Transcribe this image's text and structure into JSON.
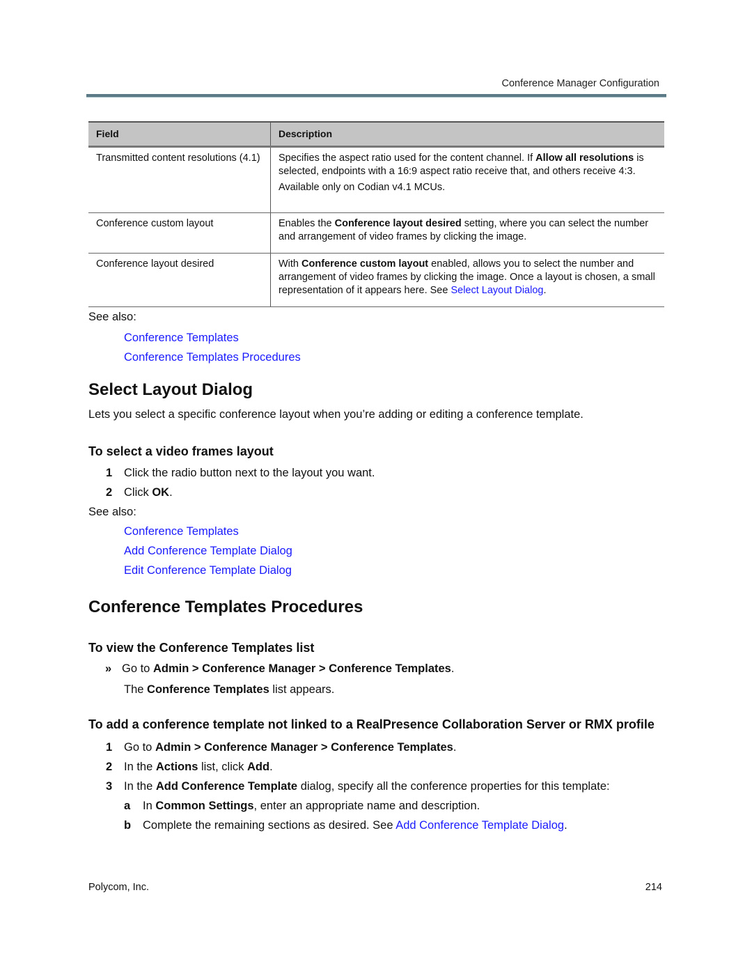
{
  "header": {
    "running_title": "Conference Manager Configuration",
    "bar_color": "#5b7a86"
  },
  "table": {
    "columns": [
      "Field",
      "Description"
    ],
    "rows": [
      {
        "field": "Transmitted content resolutions (4.1)",
        "desc1_pre": "Specifies the aspect ratio used for the content channel. If ",
        "desc1_bold": "Allow all resolutions",
        "desc1_post": " is selected, endpoints with a 16:9 aspect ratio receive that, and others receive 4:3.",
        "desc2": "Available only on Codian v4.1 MCUs."
      },
      {
        "field": "Conference custom layout",
        "desc1_pre": "Enables the ",
        "desc1_bold": "Conference layout desired",
        "desc1_post": " setting, where you can select the number and arrangement of video frames by clicking the image."
      },
      {
        "field": "Conference layout desired",
        "desc1_pre": "With ",
        "desc1_bold": "Conference custom layout",
        "desc1_post": " enabled, allows you to select the number and arrangement of video frames by clicking the image. Once a layout is chosen, a small representation of it appears here. See ",
        "desc1_link": "Select Layout Dialog",
        "desc1_end": "."
      }
    ]
  },
  "see_also_1": {
    "label": "See also:",
    "links": [
      "Conference Templates",
      "Conference Templates Procedures"
    ]
  },
  "select_layout": {
    "title": "Select Layout Dialog",
    "intro": "Lets you select a specific conference layout when you’re adding or editing a conference template.",
    "procedure_title": "To select a video frames layout",
    "step1": "Click the radio button next to the layout you want.",
    "step2_pre": "Click ",
    "step2_bold": "OK",
    "step2_post": ".",
    "see_also_label": "See also:",
    "links": [
      "Conference Templates",
      "Add Conference Template Dialog",
      "Edit Conference Template Dialog"
    ]
  },
  "procedures": {
    "title": "Conference Templates Procedures",
    "view_title": "To view the Conference Templates list",
    "view_bullet": "»",
    "view_step_pre": "Go to ",
    "view_step_bold": "Admin > Conference Manager > Conference Templates",
    "view_step_post": ".",
    "view_result_pre": "The ",
    "view_result_bold": "Conference Templates",
    "view_result_post": " list appears.",
    "add_title": "To add a conference template not linked to a RealPresence Collaboration Server or RMX profile",
    "add_steps": [
      {
        "num": "1",
        "pre": "Go to ",
        "bold": "Admin > Conference Manager > Conference Templates",
        "post": "."
      },
      {
        "num": "2",
        "pre": "In the ",
        "bold": "Actions",
        "mid": " list, click ",
        "bold2": "Add",
        "post": "."
      },
      {
        "num": "3",
        "pre": "In the ",
        "bold": "Add Conference Template",
        "post": " dialog, specify all the conference properties for this template:"
      },
      {
        "num": "a",
        "pre": "In ",
        "bold": "Common Settings",
        "post": ", enter an appropriate name and description."
      },
      {
        "num": "b",
        "pre": "Complete the remaining sections as desired. See ",
        "link": "Add Conference Template Dialog",
        "post": "."
      }
    ]
  },
  "footer": {
    "company": "Polycom, Inc.",
    "page_number": "214"
  }
}
